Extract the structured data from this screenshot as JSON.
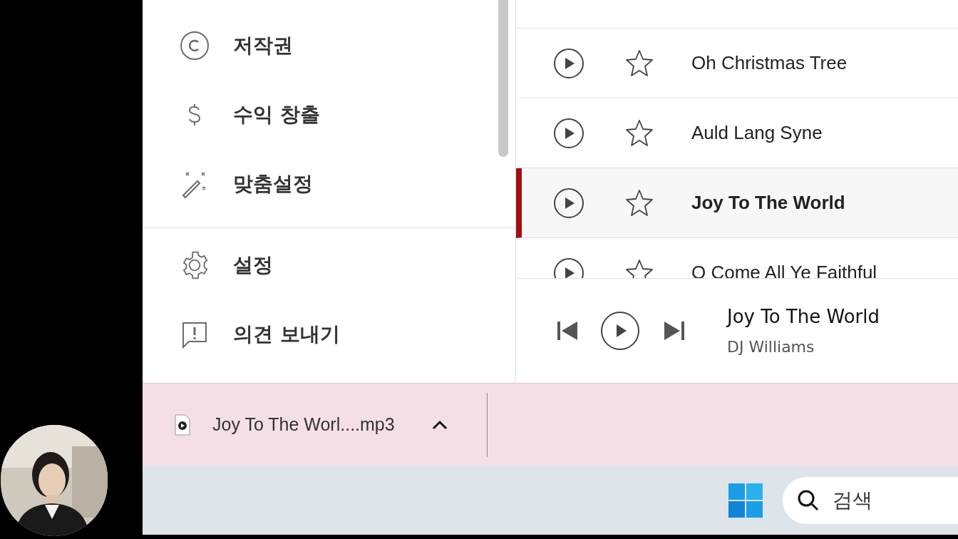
{
  "sidebar": {
    "items": [
      {
        "kind": "copyright",
        "label": "저작권"
      },
      {
        "kind": "dollar",
        "label": "수익 창출"
      },
      {
        "kind": "wand",
        "label": "맞춤설정",
        "divider_after": true
      },
      {
        "kind": "gear",
        "label": "설정"
      },
      {
        "kind": "feedback",
        "label": "의견 보내기"
      }
    ]
  },
  "songs": [
    {
      "title": "Oh Christmas Tree",
      "selected": false
    },
    {
      "title": "Auld Lang Syne",
      "selected": false
    },
    {
      "title": "Joy To The World",
      "selected": true
    },
    {
      "title": "O Come All Ye Faithful",
      "selected": false
    }
  ],
  "player": {
    "title": "Joy To The World",
    "artist": "DJ Williams"
  },
  "download_bar": {
    "file": "Joy To The Worl....mp3"
  },
  "taskbar": {
    "search_placeholder": "검색"
  }
}
